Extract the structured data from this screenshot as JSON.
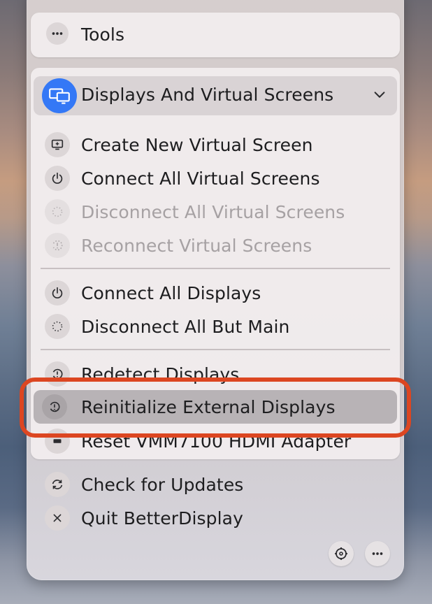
{
  "tools": {
    "label": "Tools",
    "icon": "ellipsis-icon"
  },
  "section": {
    "title": "Displays And Virtual Screens",
    "icon": "displays-icon",
    "accent": "#3478f6"
  },
  "items": [
    {
      "label": "Create New Virtual Screen",
      "icon": "virtual-screen-plus-icon",
      "enabled": true
    },
    {
      "label": "Connect All Virtual Screens",
      "icon": "power-icon",
      "enabled": true
    },
    {
      "label": "Disconnect All Virtual Screens",
      "icon": "dotted-circle-icon",
      "enabled": false
    },
    {
      "label": "Reconnect Virtual Screens",
      "icon": "reconnect-icon",
      "enabled": false
    },
    {
      "label": "Connect All Displays",
      "icon": "power-icon",
      "enabled": true
    },
    {
      "label": "Disconnect All But Main",
      "icon": "dotted-circle-icon",
      "enabled": true
    },
    {
      "label": "Redetect Displays",
      "icon": "redetect-icon",
      "enabled": true
    },
    {
      "label": "Reinitialize External Displays",
      "icon": "reinitialize-icon",
      "enabled": true,
      "highlighted": true
    },
    {
      "label": "Reset VMM7100 HDMI Adapter",
      "icon": "adapter-icon",
      "enabled": true
    }
  ],
  "footer_items": [
    {
      "label": "Check for Updates",
      "icon": "refresh-icon"
    },
    {
      "label": "Quit BetterDisplay",
      "icon": "close-icon"
    }
  ],
  "footer_buttons": [
    {
      "name": "settings-button",
      "icon": "gear-icon"
    },
    {
      "name": "more-button",
      "icon": "ellipsis-icon"
    }
  ],
  "highlight_color": "#dc4621"
}
